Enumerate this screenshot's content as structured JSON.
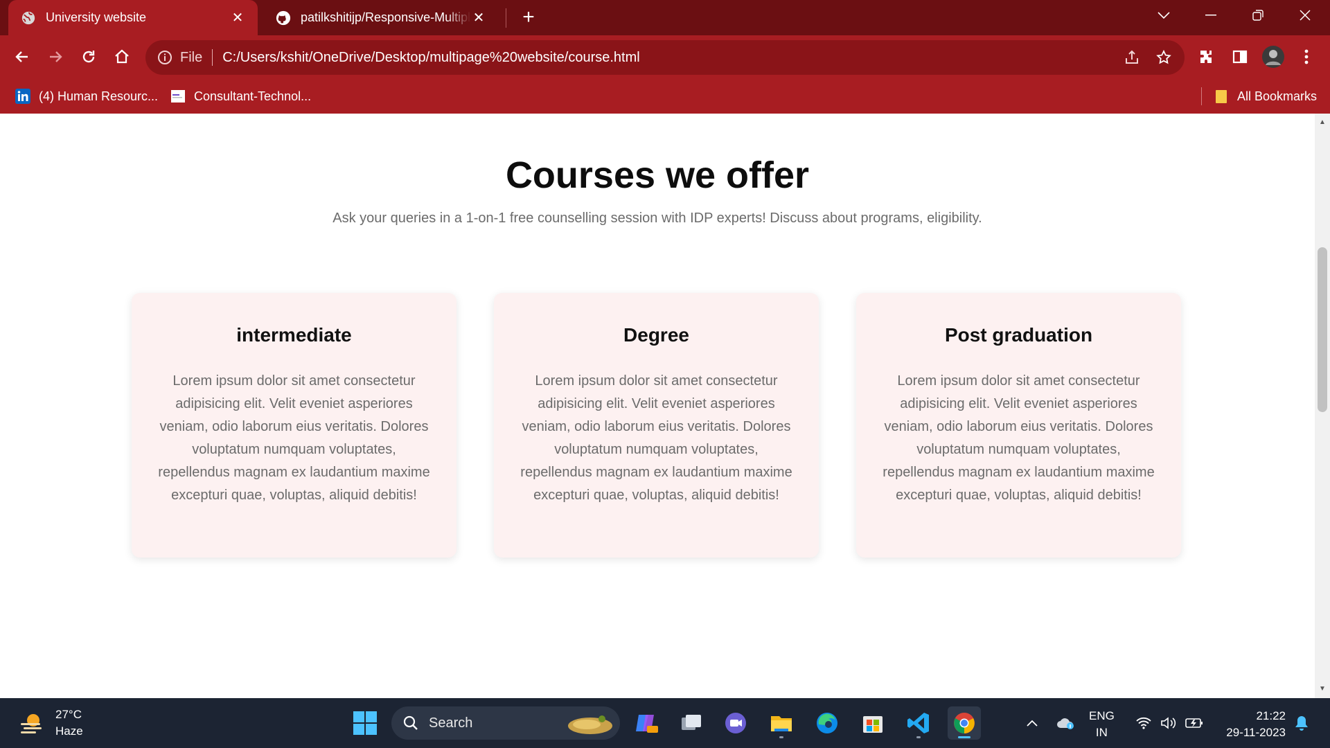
{
  "browser": {
    "tabs": [
      {
        "title": "University website",
        "active": true
      },
      {
        "title": "patilkshitijp/Responsive-Multiple",
        "active": false
      }
    ],
    "address": {
      "scheme_label": "File",
      "url": "C:/Users/kshit/OneDrive/Desktop/multipage%20website/course.html"
    },
    "bookmarks": [
      {
        "label": "(4) Human Resourc...",
        "icon": "linkedin-icon"
      },
      {
        "label": "Consultant-Technol...",
        "icon": "page-icon"
      }
    ],
    "all_bookmarks_label": "All Bookmarks",
    "colors": {
      "tabstrip": "#6b0f12",
      "toolbar": "#a81d22"
    }
  },
  "page": {
    "title": "Courses we offer",
    "subtitle": "Ask your queries in a 1-on-1 free counselling session with IDP experts! Discuss about programs, eligibility.",
    "cards": [
      {
        "title": "intermediate",
        "body": "Lorem ipsum dolor sit amet consectetur adipisicing elit. Velit eveniet asperiores veniam, odio laborum eius veritatis. Dolores voluptatum numquam voluptates, repellendus magnam ex laudantium maxime excepturi quae, voluptas, aliquid debitis!"
      },
      {
        "title": "Degree",
        "body": "Lorem ipsum dolor sit amet consectetur adipisicing elit. Velit eveniet asperiores veniam, odio laborum eius veritatis. Dolores voluptatum numquam voluptates, repellendus magnam ex laudantium maxime excepturi quae, voluptas, aliquid debitis!"
      },
      {
        "title": "Post graduation",
        "body": "Lorem ipsum dolor sit amet consectetur adipisicing elit. Velit eveniet asperiores veniam, odio laborum eius veritatis. Dolores voluptatum numquam voluptates, repellendus magnam ex laudantium maxime excepturi quae, voluptas, aliquid debitis!"
      }
    ],
    "colors": {
      "card_bg": "#fdf1f1",
      "text_muted": "#6b6b6b"
    }
  },
  "taskbar": {
    "weather": {
      "temp": "27°C",
      "condition": "Haze"
    },
    "search_label": "Search",
    "language": {
      "line1": "ENG",
      "line2": "IN"
    },
    "time": "21:22",
    "date": "29-11-2023"
  }
}
